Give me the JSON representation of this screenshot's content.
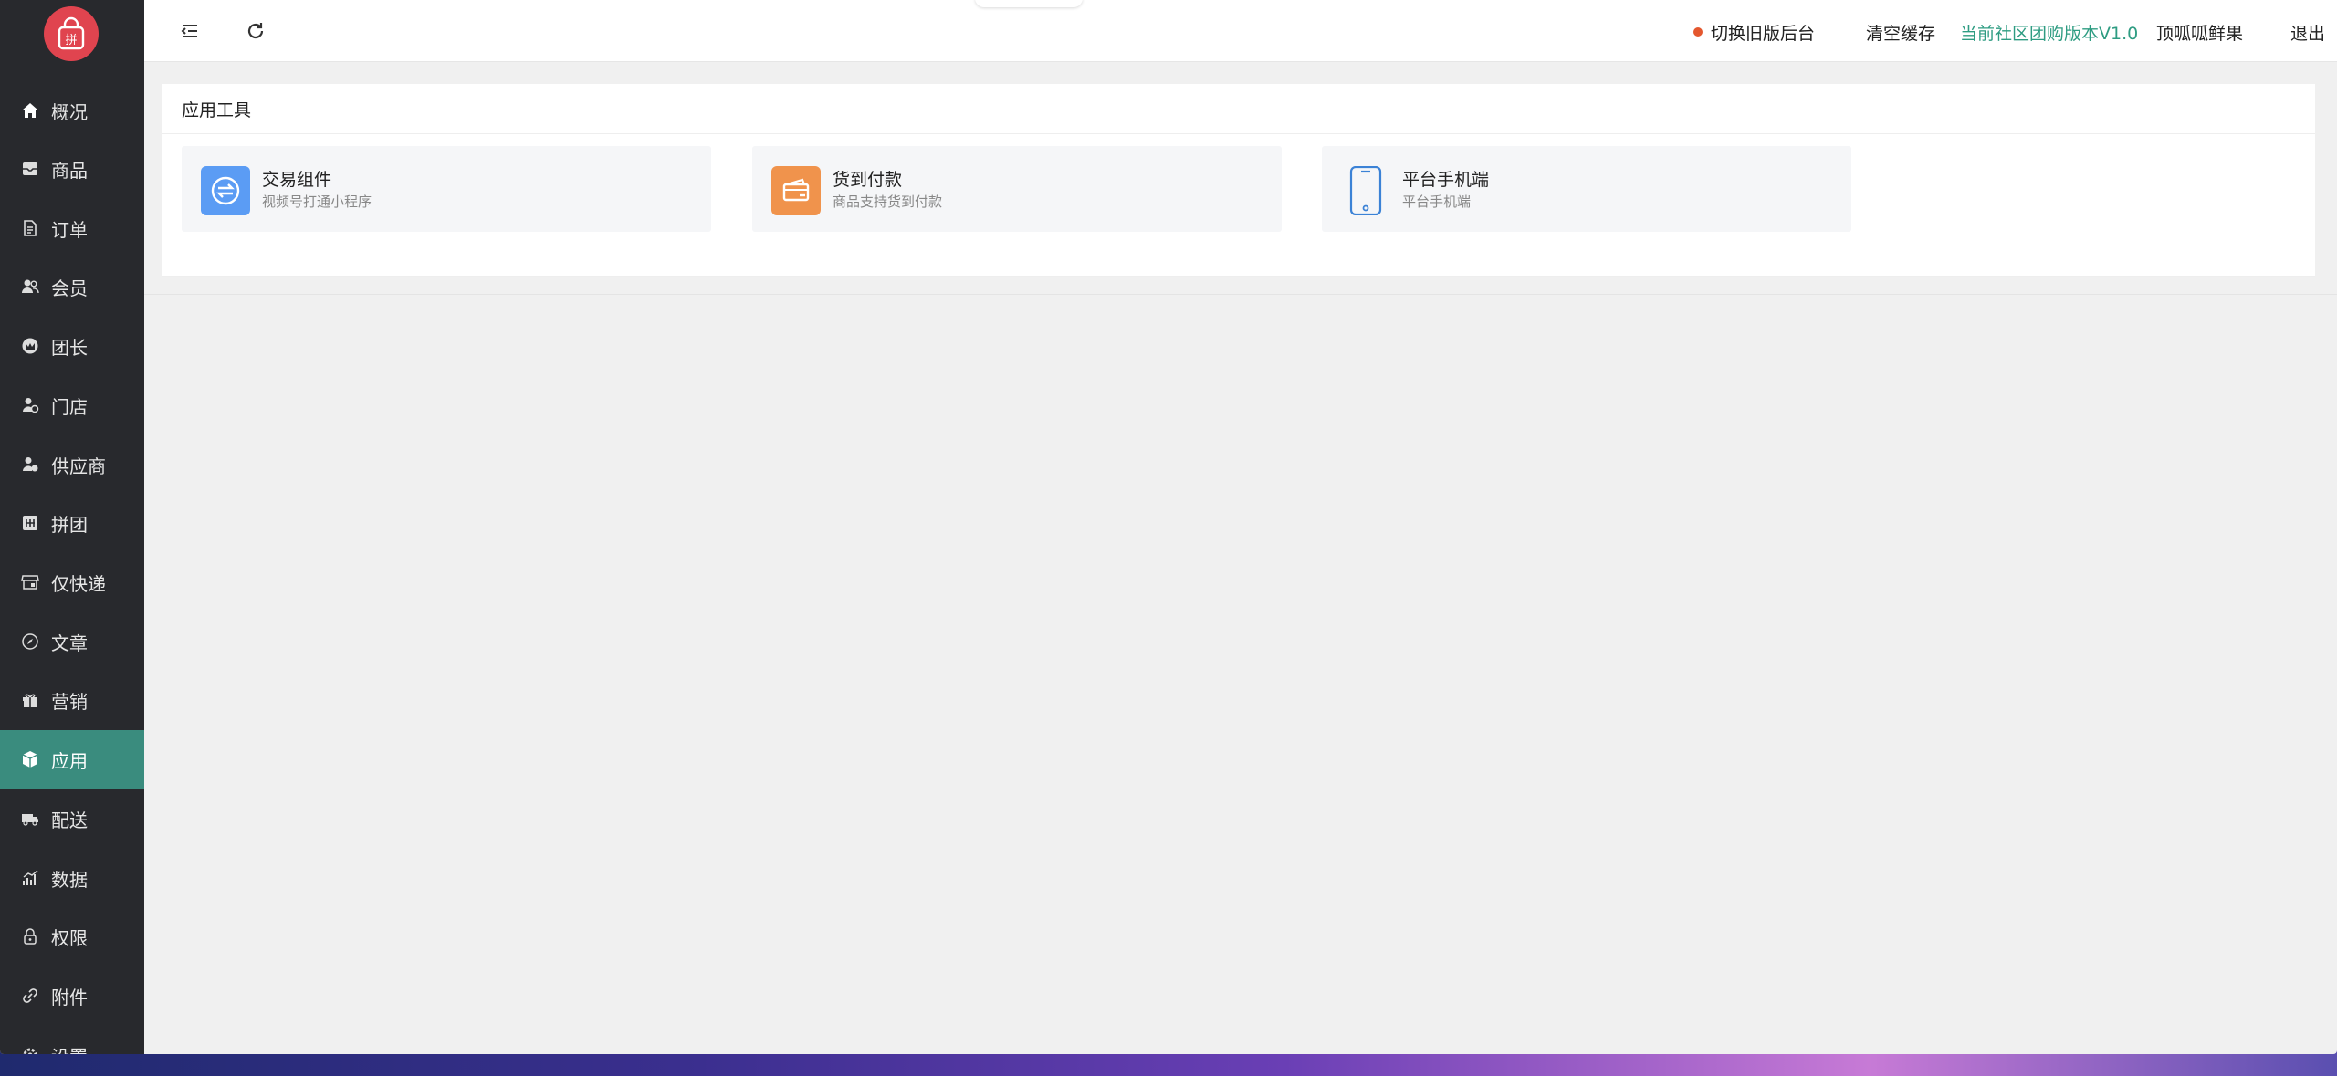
{
  "logo": {
    "glyph": "拼"
  },
  "sidebar": {
    "items": [
      {
        "label": "概况",
        "icon": "home-icon"
      },
      {
        "label": "商品",
        "icon": "inbox-icon"
      },
      {
        "label": "订单",
        "icon": "document-icon"
      },
      {
        "label": "会员",
        "icon": "users-icon"
      },
      {
        "label": "团长",
        "icon": "leader-icon"
      },
      {
        "label": "门店",
        "icon": "store-user-icon"
      },
      {
        "label": "供应商",
        "icon": "supplier-icon"
      },
      {
        "label": "拼团",
        "icon": "group-grid-icon"
      },
      {
        "label": "仅快递",
        "icon": "shop-icon"
      },
      {
        "label": "文章",
        "icon": "compass-icon"
      },
      {
        "label": "营销",
        "icon": "gift-icon"
      },
      {
        "label": "应用",
        "icon": "cube-icon",
        "active": true
      },
      {
        "label": "配送",
        "icon": "truck-icon"
      },
      {
        "label": "数据",
        "icon": "chart-icon"
      },
      {
        "label": "权限",
        "icon": "lock-icon"
      },
      {
        "label": "附件",
        "icon": "link-icon"
      },
      {
        "label": "设置",
        "icon": "gear-icon"
      }
    ]
  },
  "topbar": {
    "switch_label": "切换旧版后台",
    "clear_cache": "清空缓存",
    "version": "当前社区团购版本V1.0",
    "store_name": "顶呱呱鲜果",
    "logout": "退出",
    "version_color": "#2e9c82",
    "dot_color": "#e4572e"
  },
  "main": {
    "section_title": "应用工具",
    "tools": [
      {
        "name": "交易组件",
        "desc": "视频号打通小程序",
        "icon": "exchange-icon",
        "color": "#5b9cf4"
      },
      {
        "name": "货到付款",
        "desc": "商品支持货到付款",
        "icon": "wallet-icon",
        "color": "#f0934c"
      },
      {
        "name": "平台手机端",
        "desc": "平台手机端",
        "icon": "mobile-phone-icon",
        "color": "#3b82d6"
      }
    ]
  }
}
